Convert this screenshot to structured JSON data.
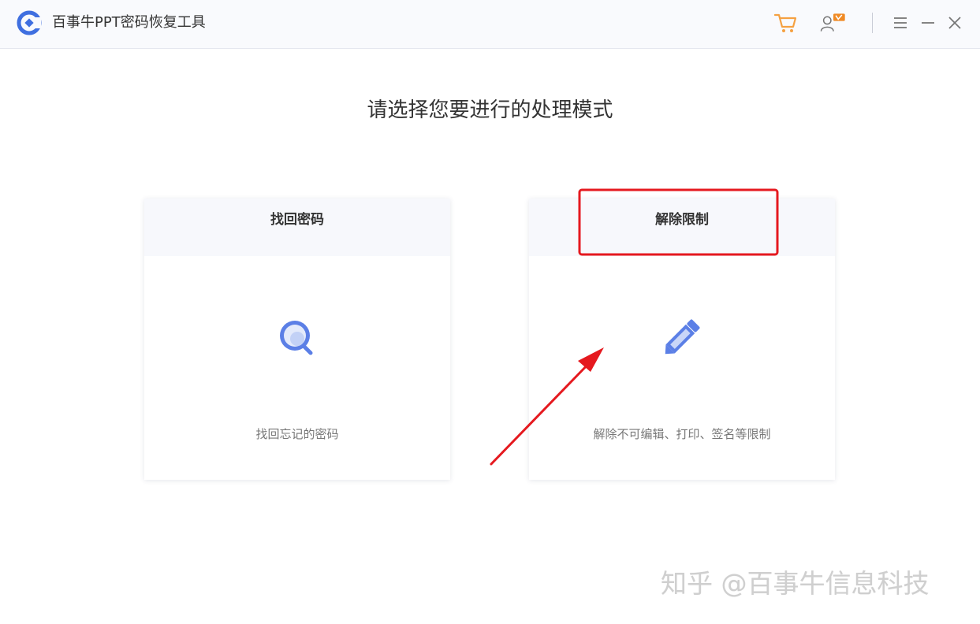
{
  "app": {
    "title": "百事牛PPT密码恢复工具",
    "logo_icon": "app-logo-icon"
  },
  "toolbar": {
    "icons": [
      "cart-icon",
      "user-vip-icon",
      "menu-icon",
      "minimize-icon",
      "close-icon"
    ]
  },
  "main": {
    "heading": "请选择您要进行的处理模式",
    "cards": [
      {
        "title": "找回密码",
        "description": "找回忘记的密码",
        "icon": "magnifier-icon"
      },
      {
        "title": "解除限制",
        "description": "解除不可编辑、打印、签名等限制",
        "icon": "pencil-icon"
      }
    ]
  },
  "annotation": {
    "highlight_color": "#e5191f",
    "arrow_color": "#e5191f"
  },
  "watermark": {
    "text": "知乎 @百事牛信息科技"
  },
  "colors": {
    "accent": "#5b7fe6",
    "cart": "#f5a142",
    "vip": "#f08a24"
  }
}
